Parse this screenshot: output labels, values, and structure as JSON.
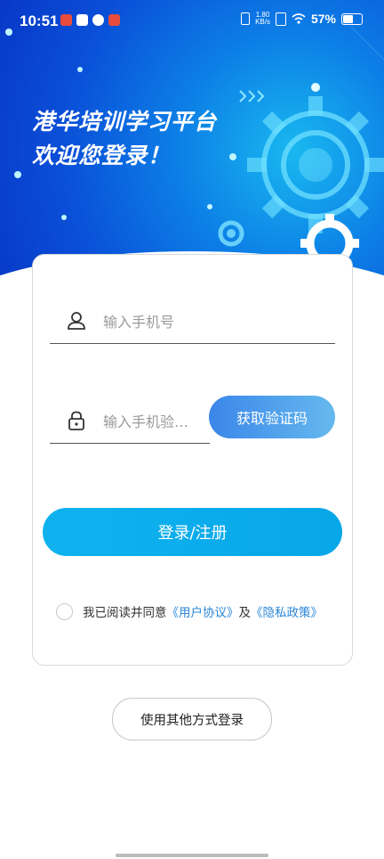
{
  "status_bar": {
    "time": "10:51",
    "net_speed_value": "1.80",
    "net_speed_unit": "KB/s",
    "battery": "57%"
  },
  "banner": {
    "line1": "港华培训学习平台",
    "line2": "欢迎您登录！"
  },
  "form": {
    "phone_placeholder": "输入手机号",
    "code_placeholder": "输入手机验…",
    "get_code_label": "获取验证码",
    "login_label": "登录/注册"
  },
  "agreement": {
    "prefix": "我已阅读并同意",
    "user_agreement": "《用户协议》",
    "and": "及",
    "privacy_policy": "《隐私政策》"
  },
  "other_login_label": "使用其他方式登录",
  "colors": {
    "banner_blue": "#0a4fd8",
    "primary_button": "#0fb2ef",
    "link": "#2b87d8"
  }
}
